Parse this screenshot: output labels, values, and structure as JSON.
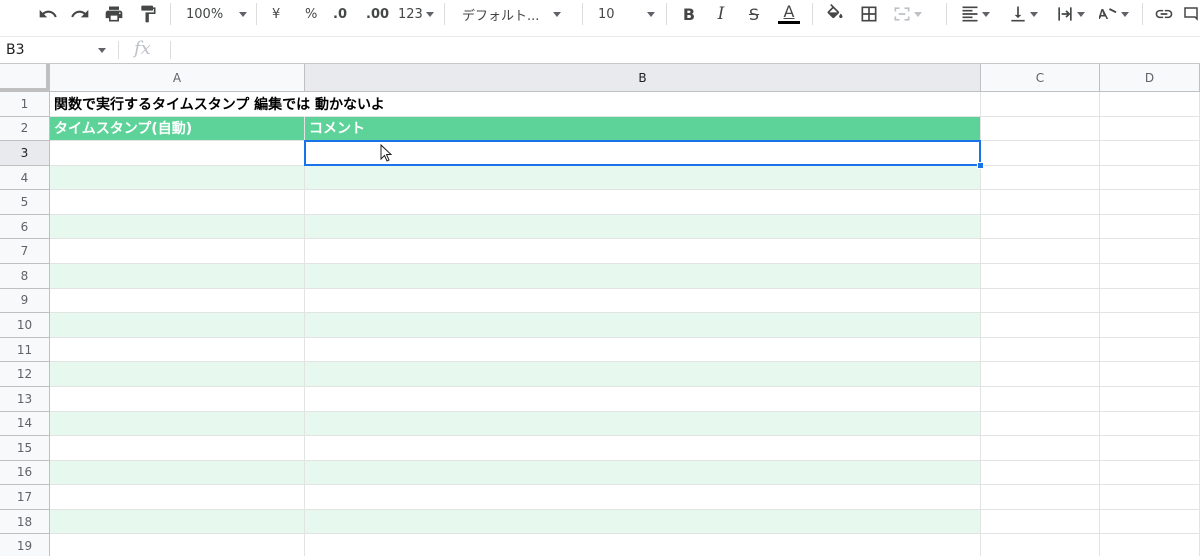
{
  "toolbar": {
    "zoom": "100%",
    "currency": "¥",
    "percent": "%",
    "decrease_decimal": ".0",
    "increase_decimal": ".00",
    "more_formats": "123",
    "font_family": "デフォルト...",
    "font_size": "10",
    "bold": "B",
    "italic": "I",
    "strikethrough": "S",
    "text_color": "A",
    "icons": [
      "undo-icon",
      "redo-icon",
      "print-icon",
      "paint-format-icon",
      "fill-color-icon",
      "borders-icon",
      "merge-cells-icon",
      "horizontal-align-icon",
      "vertical-align-icon",
      "text-wrap-icon",
      "text-rotation-icon",
      "insert-link-icon",
      "insert-comment-icon"
    ]
  },
  "formula_bar": {
    "name_box": "B3",
    "fx_label": "fx",
    "formula": ""
  },
  "columns": [
    "A",
    "B",
    "C",
    "D"
  ],
  "rows": [
    "1",
    "2",
    "3",
    "4",
    "5",
    "6",
    "7",
    "8",
    "9",
    "10",
    "11",
    "12",
    "13",
    "14",
    "15",
    "16",
    "17",
    "18",
    "19"
  ],
  "cells": {
    "A1": "関数で実行するタイムスタンプ  編集では 動かないよ",
    "A2": "タイムスタンプ(自動)",
    "B2": "コメント"
  },
  "selected_cell": "B3",
  "colors": {
    "table_header": "#5dd39a",
    "table_band": "#e7f9ef",
    "selection": "#1a73e8"
  }
}
